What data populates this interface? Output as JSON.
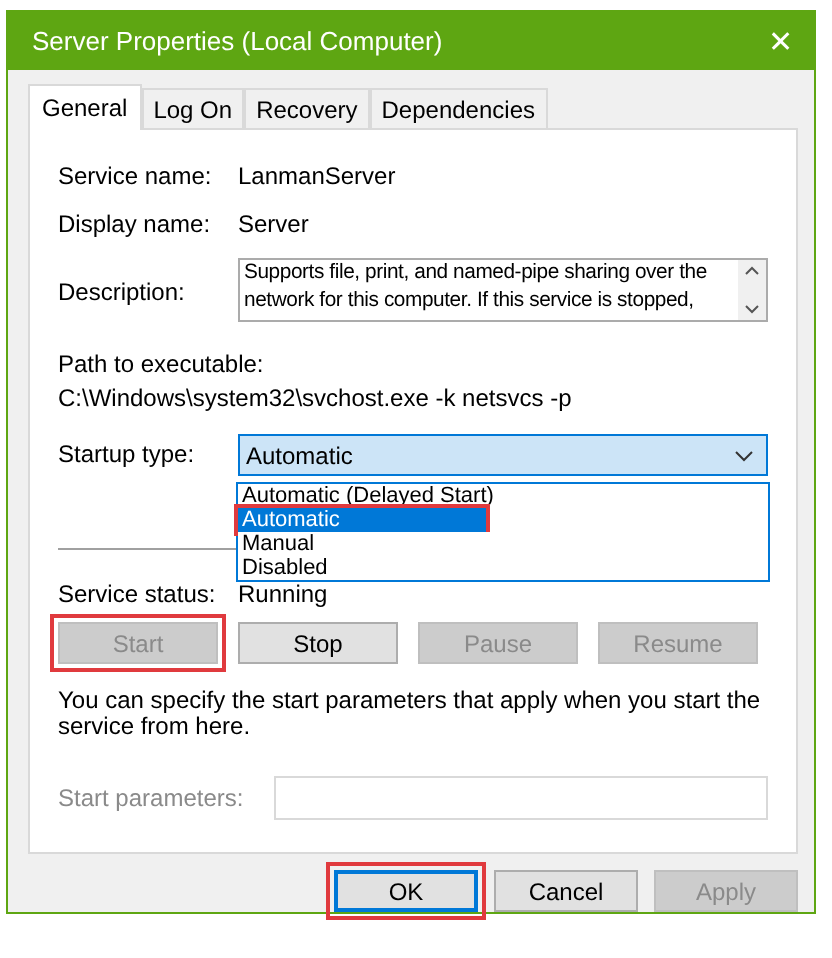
{
  "window": {
    "title": "Server Properties (Local Computer)",
    "close": "✕"
  },
  "tabs": [
    {
      "label": "General",
      "selected": true
    },
    {
      "label": "Log On",
      "selected": false
    },
    {
      "label": "Recovery",
      "selected": false
    },
    {
      "label": "Dependencies",
      "selected": false
    }
  ],
  "service_name": {
    "label": "Service name:",
    "value": "LanmanServer"
  },
  "display_name": {
    "label": "Display name:",
    "value": "Server"
  },
  "description": {
    "label": "Description:",
    "value": "Supports file, print, and named-pipe sharing over the network for this computer. If this service is stopped,"
  },
  "path": {
    "label": "Path to executable:",
    "value": "C:\\Windows\\system32\\svchost.exe -k netsvcs -p"
  },
  "startup_type": {
    "label": "Startup type:",
    "value": "Automatic",
    "expanded": true,
    "options": [
      {
        "label": "Automatic (Delayed Start)",
        "selected": false,
        "highlighted": false
      },
      {
        "label": "Automatic",
        "selected": true,
        "highlighted": true
      },
      {
        "label": "Manual",
        "selected": false,
        "highlighted": false
      },
      {
        "label": "Disabled",
        "selected": false,
        "highlighted": false
      }
    ]
  },
  "service_status": {
    "label": "Service status:",
    "value": "Running"
  },
  "service_buttons": [
    {
      "label": "Start",
      "disabled": true,
      "highlighted": true
    },
    {
      "label": "Stop",
      "disabled": false,
      "highlighted": false
    },
    {
      "label": "Pause",
      "disabled": true,
      "highlighted": false
    },
    {
      "label": "Resume",
      "disabled": true,
      "highlighted": false
    }
  ],
  "hint": "You can specify the start parameters that apply when you start the service from here.",
  "start_parameters": {
    "label": "Start parameters:",
    "disabled": true
  },
  "dialog_buttons": [
    {
      "label": "OK",
      "disabled": false,
      "highlighted": true,
      "default": true
    },
    {
      "label": "Cancel",
      "disabled": false,
      "highlighted": false,
      "default": false
    },
    {
      "label": "Apply",
      "disabled": true,
      "highlighted": false,
      "default": false
    }
  ]
}
